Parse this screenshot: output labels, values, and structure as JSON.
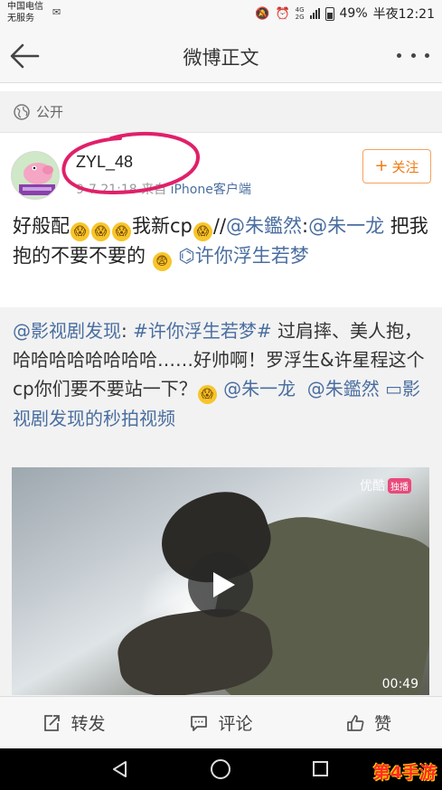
{
  "status_bar": {
    "carrier_line1": "中国电信",
    "carrier_line2": "无服务",
    "net_top": "4G",
    "net_bottom": "2G",
    "battery": "49%",
    "battery_level": 0.49,
    "time": "半夜12:21"
  },
  "nav": {
    "title": "微博正文"
  },
  "privacy": {
    "label": "公开"
  },
  "author": {
    "username": "ZYL_48",
    "meta_time": "9-7 21:18",
    "meta_from": "来自",
    "meta_source": "iPhone客户端",
    "follow_label": "关注"
  },
  "post": {
    "t1": "好般配",
    "t2": "我新cp",
    "t3": "//",
    "mention1": "@朱鑑然",
    "colon": ":",
    "mention2": "@朱一龙",
    "t4": " 把我抱的不要不要的 ",
    "topic_link": "许你浮生若梦"
  },
  "repost": {
    "mention": "@影视剧发现",
    "colon": ": ",
    "hashtag": "#许你浮生若梦#",
    "body": " 过肩摔、美人抱，哈哈哈哈哈哈哈哈……好帅啊！罗浮生&许星程这个cp你们要不要站一下？",
    "mention2": "@朱一龙",
    "mention3": "@朱鑑然",
    "video_link": "影视剧发现的秒拍视频",
    "video_watermark": "优酷",
    "video_badge": "独播",
    "duration": "00:49"
  },
  "actions": {
    "repost": "转发",
    "comment": "评论",
    "like": "赞"
  },
  "watermark": {
    "text": "第4手游"
  },
  "colors": {
    "link": "#4a6ea0",
    "follow_orange": "#f07a12",
    "annotation_ring": "#e0206a"
  }
}
